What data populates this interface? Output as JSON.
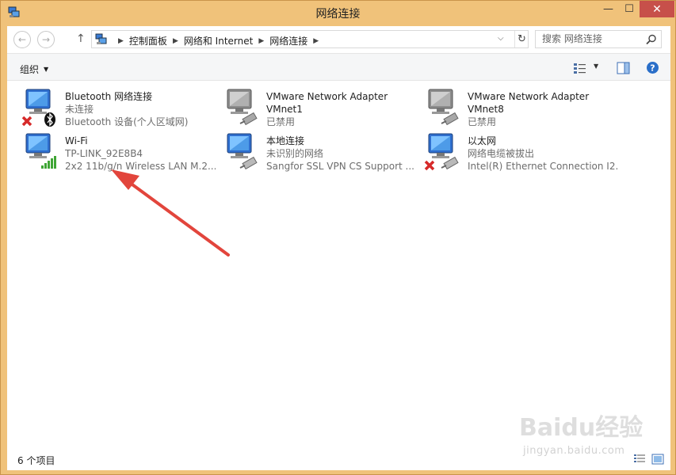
{
  "window": {
    "title": "网络连接",
    "min_glyph": "—",
    "max_glyph": "☐",
    "close_glyph": "✕"
  },
  "address": {
    "breadcrumbs": [
      "控制面板",
      "网络和 Internet",
      "网络连接"
    ],
    "search_placeholder": "搜索 网络连接"
  },
  "toolbar": {
    "organize_label": "组织"
  },
  "connections": [
    {
      "name": "Bluetooth 网络连接",
      "line2": "未连接",
      "line3": "Bluetooth 设备(个人区域网)",
      "badge": "x-icon",
      "overlay": "bluetooth-icon",
      "style": "color"
    },
    {
      "name": "VMware Network Adapter",
      "line2": "VMnet1",
      "line3": "已禁用",
      "badge": "",
      "overlay": "",
      "style": "gray"
    },
    {
      "name": "VMware Network Adapter",
      "line2": "VMnet8",
      "line3": "已禁用",
      "badge": "",
      "overlay": "",
      "style": "gray"
    },
    {
      "name": "Wi-Fi",
      "line2": "TP-LINK_92E8B4",
      "line3": "2x2 11b/g/n Wireless LAN M.2...",
      "badge": "",
      "overlay": "signal-bars-icon",
      "style": "color"
    },
    {
      "name": "本地连接",
      "line2": "未识别的网络",
      "line3": "Sangfor SSL VPN CS Support ...",
      "badge": "",
      "overlay": "",
      "style": "color"
    },
    {
      "name": "以太网",
      "line2": "网络电缆被拔出",
      "line3": "Intel(R) Ethernet Connection I2...",
      "badge": "x-icon",
      "overlay": "",
      "style": "color"
    }
  ],
  "status": {
    "item_count": "6 个项目"
  },
  "watermark": {
    "logo": "Baidu经验",
    "url": "jingyan.baidu.com"
  },
  "colors": {
    "window_frame": "#f0c27a",
    "close_button": "#c7504a",
    "arrow": "#e2453c",
    "signal": "#3fa535"
  }
}
